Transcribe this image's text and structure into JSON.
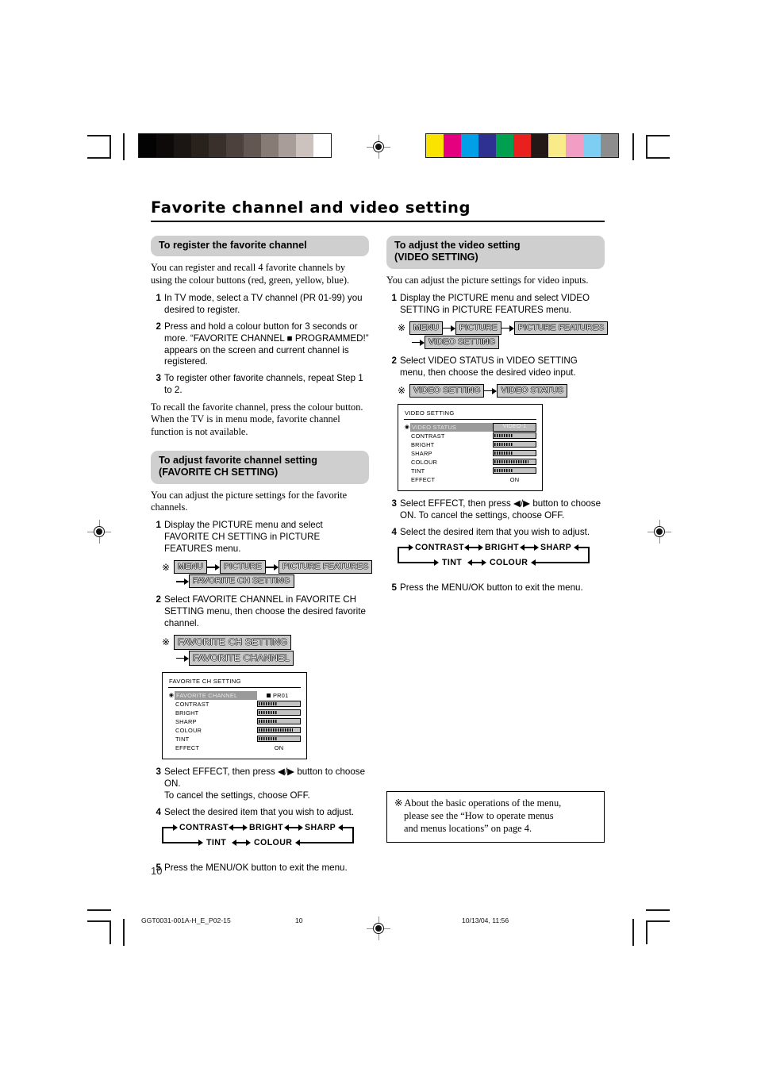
{
  "document": {
    "title": "Favorite channel and video setting",
    "page_number": "10"
  },
  "left_column": {
    "section1": {
      "heading": "To register the favorite channel",
      "intro": "You can register and recall 4 favorite channels by using the colour buttons (red, green, yellow, blue).",
      "steps": [
        {
          "num": "1",
          "text": "In TV mode, select a TV channel (PR 01-99) you desired to register."
        },
        {
          "num": "2",
          "text": "Press and hold a colour button for 3 seconds or more. “FAVORITE CHANNEL ■ PROGRAMMED!” appears on the screen and current channel is registered."
        },
        {
          "num": "3",
          "text": "To register other favorite channels, repeat Step 1 to 2."
        }
      ],
      "outro": "To recall the favorite channel, press the colour button.\nWhen the TV is in menu mode, favorite channel function is not available."
    },
    "section2": {
      "heading_line1": "To adjust favorite channel setting",
      "heading_line2": "(FAVORITE CH SETTING)",
      "intro": "You can adjust the picture settings for the favorite channels.",
      "step1": {
        "num": "1",
        "text": "Display the PICTURE menu and select FAVORITE CH SETTING in PICTURE FEATURES menu."
      },
      "flow1": {
        "asterisk": "※",
        "boxes_row1": [
          "MENU",
          "PICTURE",
          "PICTURE FEATURES"
        ],
        "boxes_row2": [
          "FAVORITE CH SETTING"
        ]
      },
      "step2": {
        "num": "2",
        "text": "Select FAVORITE CHANNEL in FAVORITE CH SETTING menu, then choose the desired favorite channel."
      },
      "flow2": {
        "asterisk": "※",
        "boxes_row1": [
          "FAVORITE CH SETTING"
        ],
        "boxes_row2": [
          "FAVORITE CHANNEL"
        ]
      },
      "osd": {
        "title": "FAVORITE CH SETTING",
        "rows": [
          {
            "label": "FAVORITE CHANNEL",
            "value": "PR01",
            "type": "selected-value",
            "highlight": true
          },
          {
            "label": "CONTRAST",
            "value": "",
            "type": "gauge",
            "fill": 46
          },
          {
            "label": "BRIGHT",
            "value": "",
            "type": "gauge",
            "fill": 46
          },
          {
            "label": "SHARP",
            "value": "",
            "type": "gauge",
            "fill": 46
          },
          {
            "label": "COLOUR",
            "value": "",
            "type": "gauge",
            "fill": 82
          },
          {
            "label": "TINT",
            "value": "",
            "type": "gauge",
            "fill": 46
          },
          {
            "label": "EFFECT",
            "value": "ON",
            "type": "text"
          }
        ]
      },
      "step3": {
        "num": "3",
        "text": "Select EFFECT, then press ◀/▶ button to choose ON.\nTo cancel the settings, choose OFF."
      },
      "step4": {
        "num": "4",
        "text": "Select the desired item that you wish to adjust."
      },
      "cycle": {
        "top": [
          "CONTRAST",
          "BRIGHT",
          "SHARP"
        ],
        "bottom": [
          "TINT",
          "COLOUR"
        ]
      },
      "step5": {
        "num": "5",
        "text": "Press the MENU/OK button to exit the menu."
      }
    }
  },
  "right_column": {
    "section1": {
      "heading_line1": "To adjust the video setting",
      "heading_line2": "(VIDEO SETTING)",
      "intro": "You can adjust the picture settings for video inputs.",
      "step1": {
        "num": "1",
        "text": "Display the PICTURE menu and select VIDEO SETTING in PICTURE FEATURES menu."
      },
      "flow1": {
        "asterisk": "※",
        "boxes_row1": [
          "MENU",
          "PICTURE",
          "PICTURE FEATURES"
        ],
        "boxes_row2": [
          "VIDEO SETTING"
        ]
      },
      "step2": {
        "num": "2",
        "text": "Select VIDEO STATUS in VIDEO SETTING menu, then choose the desired video input."
      },
      "flow2": {
        "asterisk": "※",
        "boxes_row1": [
          "VIDEO SETTING",
          "VIDEO STATUS"
        ]
      },
      "osd": {
        "title": "VIDEO SETTING",
        "rows": [
          {
            "label": "VIDEO STATUS",
            "value": "VIDEO-1",
            "type": "box-value",
            "highlight": true
          },
          {
            "label": "CONTRAST",
            "value": "",
            "type": "gauge",
            "fill": 46
          },
          {
            "label": "BRIGHT",
            "value": "",
            "type": "gauge",
            "fill": 46
          },
          {
            "label": "SHARP",
            "value": "",
            "type": "gauge",
            "fill": 46
          },
          {
            "label": "COLOUR",
            "value": "",
            "type": "gauge",
            "fill": 82
          },
          {
            "label": "TINT",
            "value": "",
            "type": "gauge",
            "fill": 46
          },
          {
            "label": "EFFECT",
            "value": "ON",
            "type": "text"
          }
        ]
      },
      "step3": {
        "num": "3",
        "text": "Select EFFECT, then press ◀/▶ button to choose ON. To cancel the settings, choose OFF."
      },
      "step4": {
        "num": "4",
        "text": "Select the desired item that you wish to adjust."
      },
      "cycle": {
        "top": [
          "CONTRAST",
          "BRIGHT",
          "SHARP"
        ],
        "bottom": [
          "TINT",
          "COLOUR"
        ]
      },
      "step5": {
        "num": "5",
        "text": "Press the MENU/OK button to exit the menu."
      }
    },
    "note": {
      "asterisk": "※",
      "line1": "About the basic operations of the menu,",
      "line2": "please see the “How to operate menus",
      "line3": "and menus locations” on page 4."
    }
  },
  "footer": {
    "file_id": "GGT0031-001A-H_E_P02-15",
    "page": "10",
    "timestamp": "10/13/04, 11:56"
  },
  "print_marks": {
    "grayscale_bar": [
      "#030303",
      "#0d0a09",
      "#1b1613",
      "#29211c",
      "#3a302b",
      "#4c413c",
      "#635751",
      "#877b75",
      "#a89d98",
      "#cdc3be",
      "#ffffff"
    ],
    "color_bar": [
      "#fbe300",
      "#e5007f",
      "#00a0e9",
      "#2e3192",
      "#00a050",
      "#e8201e",
      "#231815",
      "#faeb8a",
      "#f29ec4",
      "#7ecef4",
      "#8d8d8d"
    ]
  }
}
